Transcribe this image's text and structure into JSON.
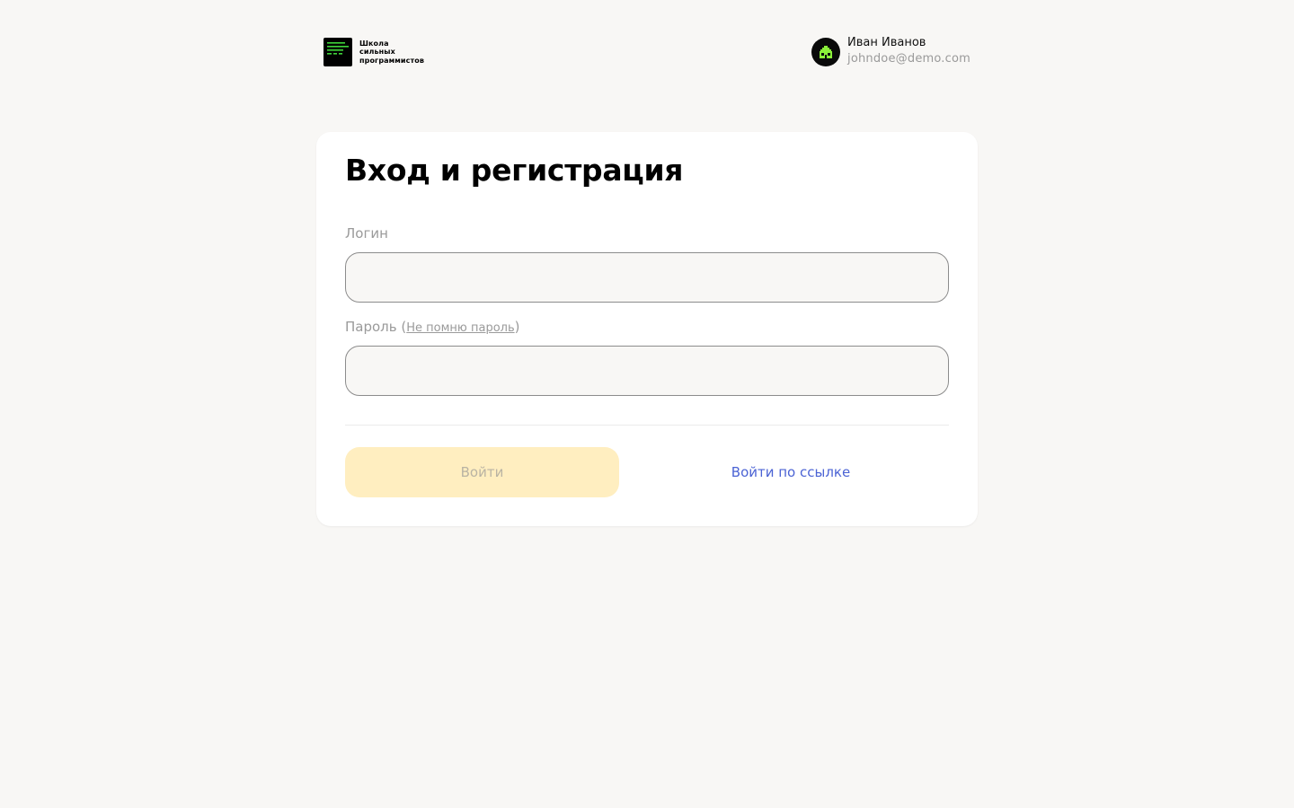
{
  "header": {
    "logo_lines": [
      "Школа",
      "сильных",
      "программистов"
    ],
    "logo_icon": "terminal-lines-icon",
    "user": {
      "name": "Иван Иванов",
      "email": "johndoe@demo.com",
      "avatar_icon": "pixel-house-avatar"
    }
  },
  "form": {
    "title": "Вход и регистрация",
    "login_label": "Логин",
    "login_value": "",
    "password_label": "Пароль",
    "password_label_open": " (",
    "password_forgot_link": "Не помню пароль",
    "password_label_close": ")",
    "password_value": "",
    "submit_label": "Войти",
    "submit_disabled": true,
    "link_login_label": "Войти по ссылке"
  },
  "colors": {
    "background": "#f8f7f5",
    "card": "#ffffff",
    "submit_disabled": "#ffeec0",
    "link": "#4b63d4",
    "accent_green": "#38d430"
  }
}
